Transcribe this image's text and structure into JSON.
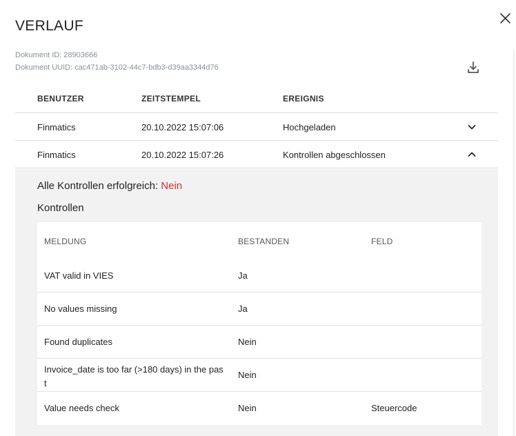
{
  "dialog": {
    "title": "VERLAUF",
    "document_id_label": "Dokument ID: 28903666",
    "document_uuid_label": "Dokument UUID: cac471ab-3102-44c7-bdb3-d39aa3344d76"
  },
  "history": {
    "columns": [
      "BENUTZER",
      "ZEITSTEMPEL",
      "EREIGNIS"
    ],
    "rows": [
      {
        "user": "Finmatics",
        "timestamp": "20.10.2022 15:07:06",
        "event": "Hochgeladen",
        "expanded": false
      },
      {
        "user": "Finmatics",
        "timestamp": "20.10.2022 15:07:26",
        "event": "Kontrollen abgeschlossen",
        "expanded": true
      }
    ]
  },
  "details": {
    "summary_label": "Alle Kontrollen erfolgreich:",
    "summary_value": "Nein",
    "summary_value_color": "#d32f2f",
    "controls_heading": "Kontrollen",
    "controls_columns": [
      "MELDUNG",
      "BESTANDEN",
      "FELD"
    ],
    "controls": [
      {
        "message": "VAT valid in VIES",
        "passed": "Ja",
        "field": ""
      },
      {
        "message": "No values missing",
        "passed": "Ja",
        "field": ""
      },
      {
        "message": "Found duplicates",
        "passed": "Nein",
        "field": ""
      },
      {
        "message": "Invoice_date is too far (>180 days) in the past",
        "passed": "Nein",
        "field": ""
      },
      {
        "message": "Value needs check",
        "passed": "Nein",
        "field": "Steuercode"
      }
    ]
  },
  "icons": {
    "close": "close-icon",
    "download": "download-icon",
    "collapse": "chevron-down-icon",
    "expand": "chevron-up-icon"
  }
}
